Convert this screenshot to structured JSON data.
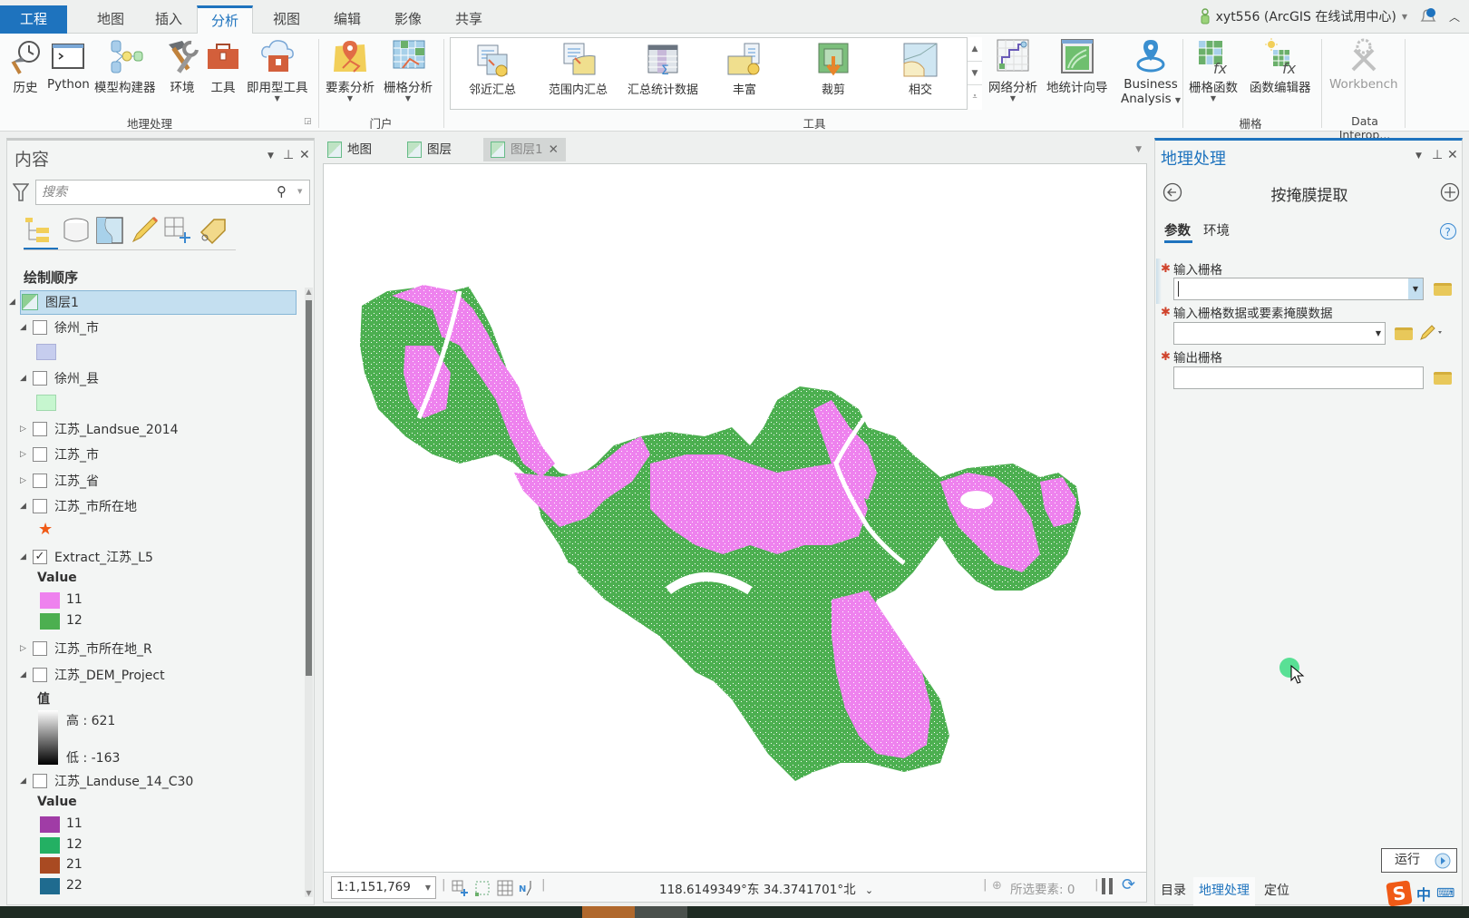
{
  "ribbon_tabs": [
    {
      "label": "工程",
      "state": "project"
    },
    {
      "label": "地图"
    },
    {
      "label": "插入"
    },
    {
      "label": "分析",
      "state": "active"
    },
    {
      "label": "视图"
    },
    {
      "label": "编辑"
    },
    {
      "label": "影像"
    },
    {
      "label": "共享"
    }
  ],
  "user": {
    "name": "xyt556 (ArcGIS 在线试用中心)"
  },
  "ribbon": {
    "geoprocessing_group": {
      "label": "地理处理",
      "buttons": [
        "历史",
        "Python",
        "模型构建器",
        "环境",
        "工具",
        "即用型工具"
      ]
    },
    "portal_group": {
      "label": "门户",
      "buttons": [
        "要素分析",
        "栅格分析"
      ]
    },
    "tools_group": {
      "label": "工具",
      "gallery": [
        "邻近汇总",
        "范围内汇总",
        "汇总统计数据",
        "丰富",
        "裁剪",
        "相交"
      ]
    },
    "extra_buttons": [
      "网络分析",
      "地统计向导",
      "Business",
      "Analysis"
    ],
    "raster_group": {
      "label": "栅格",
      "buttons": [
        "栅格函数",
        "函数编辑器"
      ]
    },
    "data_interop_group": {
      "label": "Data Interop...",
      "buttons": [
        "Workbench"
      ]
    }
  },
  "contents": {
    "title": "内容",
    "search_placeholder": "搜索",
    "draw_order_label": "绘制顺序",
    "map_name": "图层1",
    "layers": [
      {
        "name": "徐州_市",
        "checked": false,
        "expanded": true,
        "swatch": "#c6cdee"
      },
      {
        "name": "徐州_县",
        "checked": false,
        "expanded": true,
        "swatch": "#c6f6cf"
      },
      {
        "name": "江苏_Landsue_2014",
        "checked": false,
        "expanded": false
      },
      {
        "name": "江苏_市",
        "checked": false,
        "expanded": false
      },
      {
        "name": "江苏_省",
        "checked": false,
        "expanded": false
      },
      {
        "name": "江苏_市所在地",
        "checked": false,
        "expanded": true,
        "symbol": "★"
      },
      {
        "name": "Extract_江苏_L5",
        "checked": true,
        "expanded": true,
        "legend_title": "Value",
        "classes": [
          {
            "label": "11",
            "color": "#ee82ee"
          },
          {
            "label": "12",
            "color": "#4caf50"
          }
        ]
      },
      {
        "name": "江苏_市所在地_R",
        "checked": false,
        "expanded": false
      },
      {
        "name": "江苏_DEM_Project",
        "checked": false,
        "expanded": true,
        "legend_title": "值",
        "high": "高 : 621",
        "low": "低 : -163"
      },
      {
        "name": "江苏_Landuse_14_C30",
        "checked": false,
        "expanded": true,
        "legend_title": "Value",
        "classes": [
          {
            "label": "11",
            "color": "#a03ca6"
          },
          {
            "label": "12",
            "color": "#23b063"
          },
          {
            "label": "21",
            "color": "#a94a22"
          },
          {
            "label": "22",
            "color": "#1f6b8f"
          }
        ]
      }
    ]
  },
  "map_tabs": [
    {
      "label": "地图"
    },
    {
      "label": "图层"
    },
    {
      "label": "图层1",
      "active": true
    }
  ],
  "map": {
    "colors": {
      "value_11": "#ee82ee",
      "value_12": "#4caf50"
    }
  },
  "status": {
    "scale": "1:1,151,769",
    "coordinates": "118.6149349°东 34.3741701°北",
    "selected_features": "所选要素: 0"
  },
  "geoprocessing": {
    "title": "地理处理",
    "tool_name": "按掩膜提取",
    "tabs": [
      "参数",
      "环境"
    ],
    "params": [
      {
        "label": "输入栅格",
        "value": ""
      },
      {
        "label": "输入栅格数据或要素掩膜数据",
        "value": ""
      },
      {
        "label": "输出栅格",
        "value": ""
      }
    ],
    "run_label": "运行",
    "bottom_tabs": [
      "目录",
      "地理处理",
      "定位"
    ]
  },
  "ime": {
    "label": "中"
  }
}
